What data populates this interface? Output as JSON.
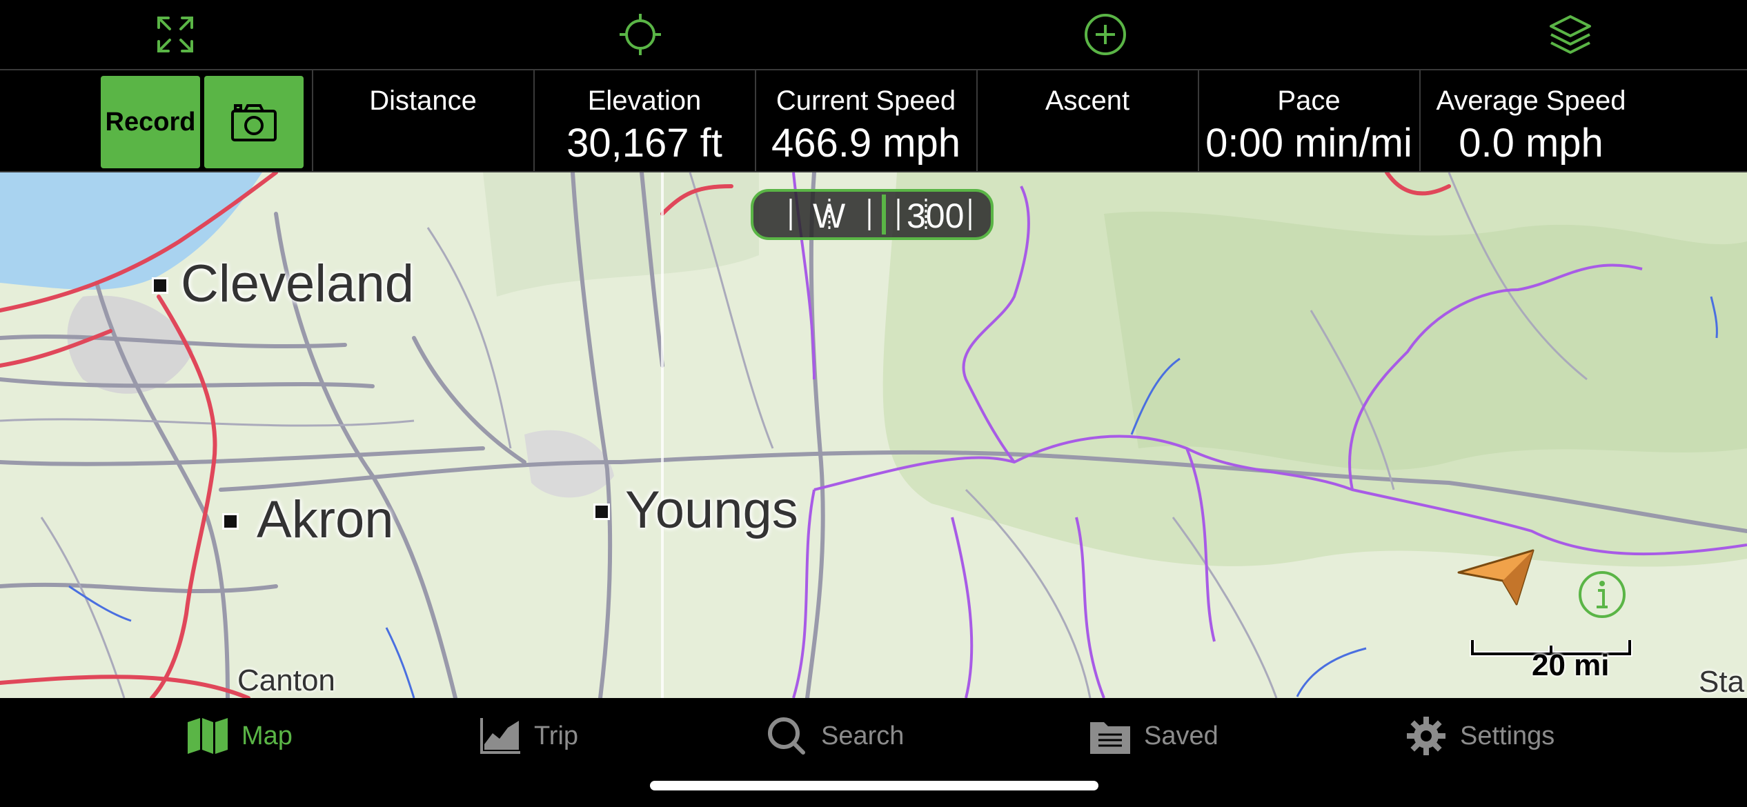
{
  "colors": {
    "accent": "#5ab546",
    "background": "#000000",
    "inactive_tab": "#8c8c8c"
  },
  "toolbar": {
    "icons": [
      "fullscreen-icon",
      "crosshair-icon",
      "zoom-plus-icon",
      "layers-icon"
    ]
  },
  "stats": {
    "record_label": "Record",
    "camera_icon": "camera-icon",
    "items": [
      {
        "label": "Distance",
        "value": ""
      },
      {
        "label": "Elevation",
        "value": "30,167 ft"
      },
      {
        "label": "Current Speed",
        "value": "466.9 mph"
      },
      {
        "label": "Ascent",
        "value": ""
      },
      {
        "label": "Pace",
        "value": "0:00 min/mi"
      },
      {
        "label": "Average Speed",
        "value": "0.0 mph"
      }
    ]
  },
  "map": {
    "cities": [
      "Cleveland",
      "Akron",
      "Youngs",
      "Canton",
      "Sta"
    ],
    "compass": {
      "direction": "W",
      "heading": "300"
    },
    "scale_label": "20 mi"
  },
  "tabs": [
    {
      "label": "Map",
      "icon": "map-icon",
      "active": true
    },
    {
      "label": "Trip",
      "icon": "trip-chart-icon",
      "active": false
    },
    {
      "label": "Search",
      "icon": "search-icon",
      "active": false
    },
    {
      "label": "Saved",
      "icon": "saved-folder-icon",
      "active": false
    },
    {
      "label": "Settings",
      "icon": "gear-icon",
      "active": false
    }
  ]
}
